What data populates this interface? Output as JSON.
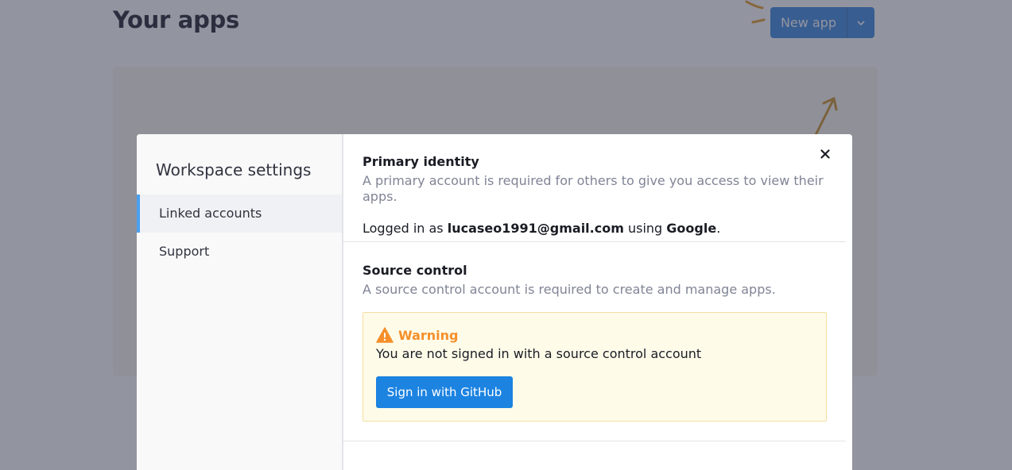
{
  "background": {
    "page_title": "Your apps",
    "new_app_label": "New app",
    "new_app_menu_icon": "chevron-down-icon"
  },
  "modal": {
    "sidebar": {
      "title": "Workspace settings",
      "items": [
        {
          "label": "Linked accounts",
          "active": true
        },
        {
          "label": "Support",
          "active": false
        }
      ]
    },
    "close_icon": "close-icon",
    "primary_identity": {
      "heading": "Primary identity",
      "description": "A primary account is required for others to give you access to view their apps.",
      "logged_in_prefix": "Logged in as ",
      "email": "lucaseo1991@gmail.com",
      "using_text": " using ",
      "provider": "Google",
      "suffix": "."
    },
    "source_control": {
      "heading": "Source control",
      "description": "A source control account is required to create and manage apps.",
      "warning": {
        "icon": "warning-triangle-icon",
        "title": "Warning",
        "message": "You are not signed in with a source control account"
      },
      "signin_button": "Sign in with GitHub"
    }
  },
  "colors": {
    "primary_button": "#1c83e1",
    "warning_accent": "#f58f2a",
    "warning_bg": "#fffbe9",
    "active_nav_indicator": "#4a9ff0"
  }
}
